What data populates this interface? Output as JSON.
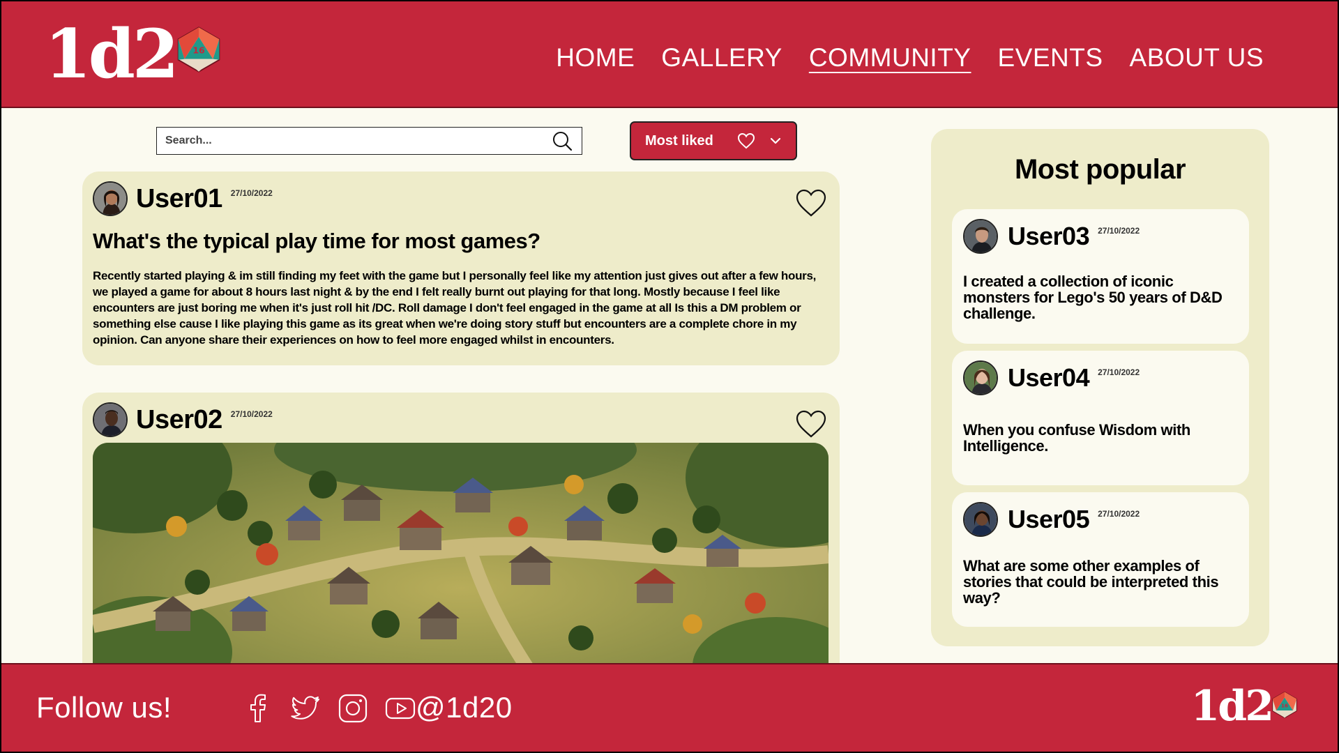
{
  "brand": {
    "logo_text": "1d2",
    "handle": "@1d20"
  },
  "colors": {
    "brand_red": "#c4263b",
    "card": "#eeecca",
    "page_bg": "#fbfaf0"
  },
  "nav": {
    "items": [
      {
        "label": "HOME"
      },
      {
        "label": "GALLERY"
      },
      {
        "label": "COMMUNITY",
        "active": true
      },
      {
        "label": "EVENTS"
      },
      {
        "label": "ABOUT US"
      }
    ]
  },
  "search": {
    "placeholder": "Search...",
    "icon": "search-icon"
  },
  "sort": {
    "label": "Most liked",
    "icons": [
      "heart-icon",
      "chevron-down-icon"
    ]
  },
  "posts": [
    {
      "user": "User01",
      "date": "27/10/2022",
      "title": "What's the typical play time for most games?",
      "body": "Recently started playing & im still finding my feet with the game but I personally feel like my attention just gives out after a few hours, we played a game for about 8 hours last night & by the end I felt really burnt out playing for that long. Mostly because I feel like encounters are just boring me when it's just roll hit /DC. Roll damage I don't feel engaged in the game at all Is this a DM problem or something else cause I like playing this game as its great when we're doing story stuff but encounters are a complete chore in my opinion. Can anyone share their experiences on how to feel more engaged whilst in encounters."
    },
    {
      "user": "User02",
      "date": "27/10/2022",
      "image": "fantasy-village-map"
    }
  ],
  "sidebar": {
    "title": "Most popular",
    "items": [
      {
        "user": "User03",
        "date": "27/10/2022",
        "text": "I created a collection of iconic monsters for Lego's 50 years of D&D challenge."
      },
      {
        "user": "User04",
        "date": "27/10/2022",
        "text": "When you confuse Wisdom with Intelligence."
      },
      {
        "user": "User05",
        "date": "27/10/2022",
        "text": "What are some other examples of stories that could be interpreted this way?"
      }
    ]
  },
  "footer": {
    "follow_label": "Follow us!",
    "socials": [
      "facebook-icon",
      "twitter-icon",
      "instagram-icon",
      "youtube-icon"
    ]
  }
}
